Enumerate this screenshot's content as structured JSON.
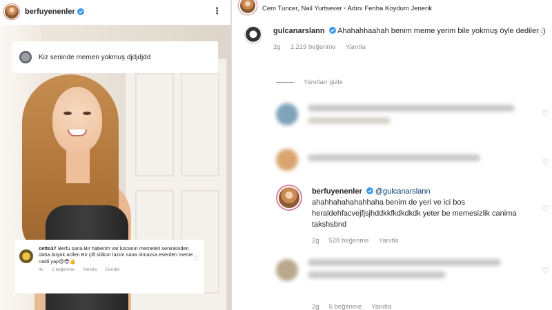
{
  "left": {
    "header": {
      "username": "berfuyenenler"
    },
    "overlay_top": {
      "comment": "Kiz seninde memen yokmuş djdjdjdd"
    },
    "overlay_bottom": {
      "username": "cetto37",
      "comment": "Berfu sana Bir haberim var kocanın memeleri seninkinden daha büyük acilen Bir çift silikon lazım sana olmazsa eserden meme nakli yap😢😎👍",
      "time": "4s",
      "likes": "1 beğenme",
      "reply": "Yanıtla",
      "send": "Gönder"
    }
  },
  "right": {
    "music": {
      "artists": "Cem Tuncer, Nail Yurtsever",
      "separator": "•",
      "song": "Adını Feriha Koydum Jenerik"
    },
    "comment1": {
      "username": "gulcanarslann",
      "text": "Ahahahhaahah benim meme yerim bile yokmuş öyle dediler :)",
      "time": "2g",
      "likes": "1.219 beğenme",
      "reply": "Yanıtla"
    },
    "hide_replies": "Yanıtları gizle",
    "comment2": {
      "username": "berfuyenenler",
      "mention": "@gulcanarslann",
      "text": "ahahhahahahahhaha benim de yeri ve ici bos heraldehfacvejfjsjhddkkfkdkdkdk yeter be memesizlik canima takshsbnd",
      "time": "2g",
      "likes": "528 beğenme",
      "reply": "Yanıtla"
    },
    "bottom_meta": {
      "time": "2g",
      "likes": "5 beğenme",
      "reply": "Yanıtla"
    }
  },
  "colors": {
    "verified": "#3897f0",
    "meta_gray": "#8e8e8e",
    "mention": "#00376b"
  }
}
